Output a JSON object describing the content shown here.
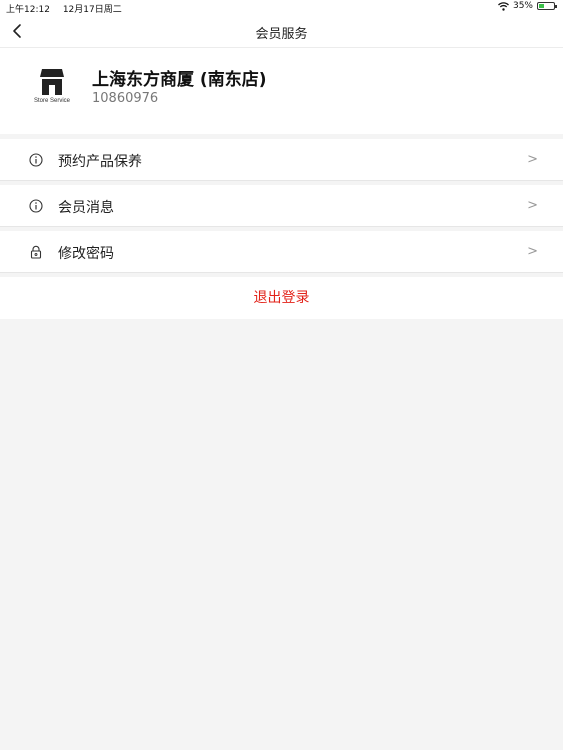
{
  "status_bar": {
    "time": "上午12:12",
    "date": "12月17日周二",
    "battery": "35%",
    "battery_level": 0.35,
    "wifi_icon": "wifi-icon"
  },
  "nav": {
    "title": "会员服务",
    "back_icon": "chevron-left-icon"
  },
  "store": {
    "name": "上海东方商厦 (南东店)",
    "id": "10860976",
    "logo_caption": "Store Service",
    "logo_icon": "store-icon"
  },
  "menu": [
    {
      "label": "预约产品保养",
      "icon": "info-icon",
      "chevron": ">"
    },
    {
      "label": "会员消息",
      "icon": "info-icon",
      "chevron": ">"
    },
    {
      "label": "修改密码",
      "icon": "lock-icon",
      "chevron": ">"
    }
  ],
  "logout_label": "退出登录",
  "colors": {
    "accent_red": "#e2231a",
    "background": "#f4f4f4"
  }
}
